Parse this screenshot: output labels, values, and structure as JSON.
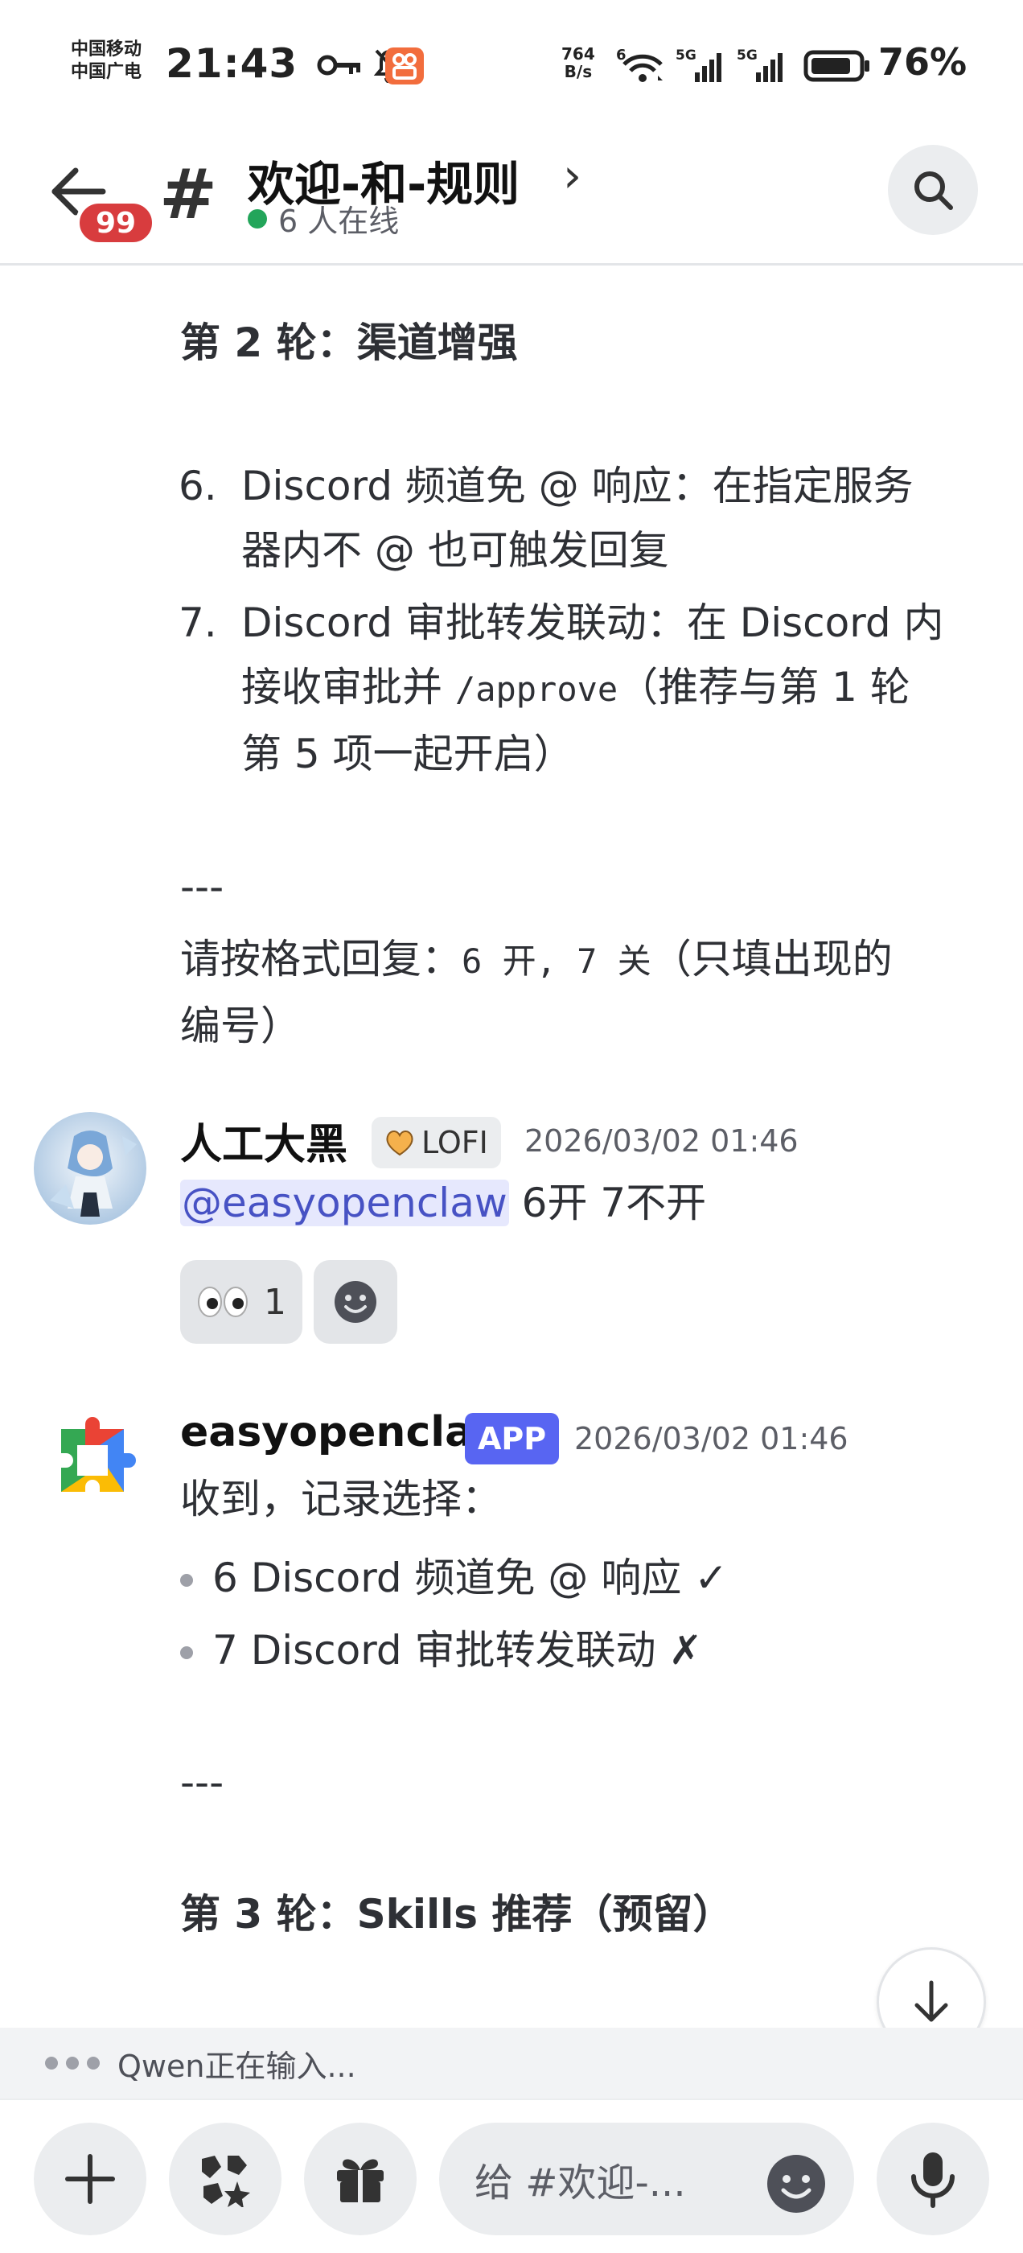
{
  "status_bar": {
    "carrier_line1": "中国移动",
    "carrier_line2": "中国广电",
    "time": "21:43",
    "net_speed_value": "764",
    "net_speed_unit": "B/s",
    "wifi_label": "6",
    "signal1_label": "5G",
    "signal2_label": "5G",
    "battery_percent": "76%"
  },
  "header": {
    "unread_badge": "99",
    "hash": "#",
    "channel_name": "欢迎-和-规则",
    "chevron": "›",
    "online_text": "6 人在线"
  },
  "message_bot_prev": {
    "round2_heading": "第 2 轮：渠道增强",
    "items": [
      {
        "num": "6.",
        "line1": "Discord 频道免 @ 响应：在指定服务",
        "line2": "器内不 @ 也可触发回复"
      },
      {
        "num": "7.",
        "line1": "Discord 审批转发联动：在 Discord 内",
        "line2a": "接收审批并 ",
        "line2_code": "/approve",
        "line2b": "（推荐与第 1 轮",
        "line3": "第 5 项一起开启）"
      }
    ],
    "separator": "---",
    "reply_prompt_a": "请按格式回复：",
    "reply_prompt_code": "6 开, 7 关",
    "reply_prompt_b": "（只填出现的",
    "reply_prompt_line2": "编号）"
  },
  "message_user": {
    "author": "人工大黑",
    "tag_label": "LOFI",
    "timestamp": "2026/03/02 01:46",
    "mention": "@easyopenclaw",
    "text": " 6开 7不开",
    "reaction_count": "1"
  },
  "message_bot": {
    "author": "easyopenclaw",
    "tag_label": "APP",
    "timestamp": "2026/03/02 01:46",
    "intro": "收到，记录选择：",
    "bullets": [
      "6 Discord 频道免 @ 响应 ✓",
      "7 Discord 审批转发联动 ✗"
    ],
    "separator": "---",
    "round3_heading": "第 3 轮：Skills 推荐（预留）"
  },
  "typing": {
    "text": "Qwen正在输入..."
  },
  "composer": {
    "placeholder": "给 #欢迎-..."
  },
  "colors": {
    "online": "#23a55a",
    "badge": "#d83c3e",
    "app_tag": "#5865f2",
    "mention_bg": "#e6e8fd",
    "mention_text": "#4752c4"
  }
}
